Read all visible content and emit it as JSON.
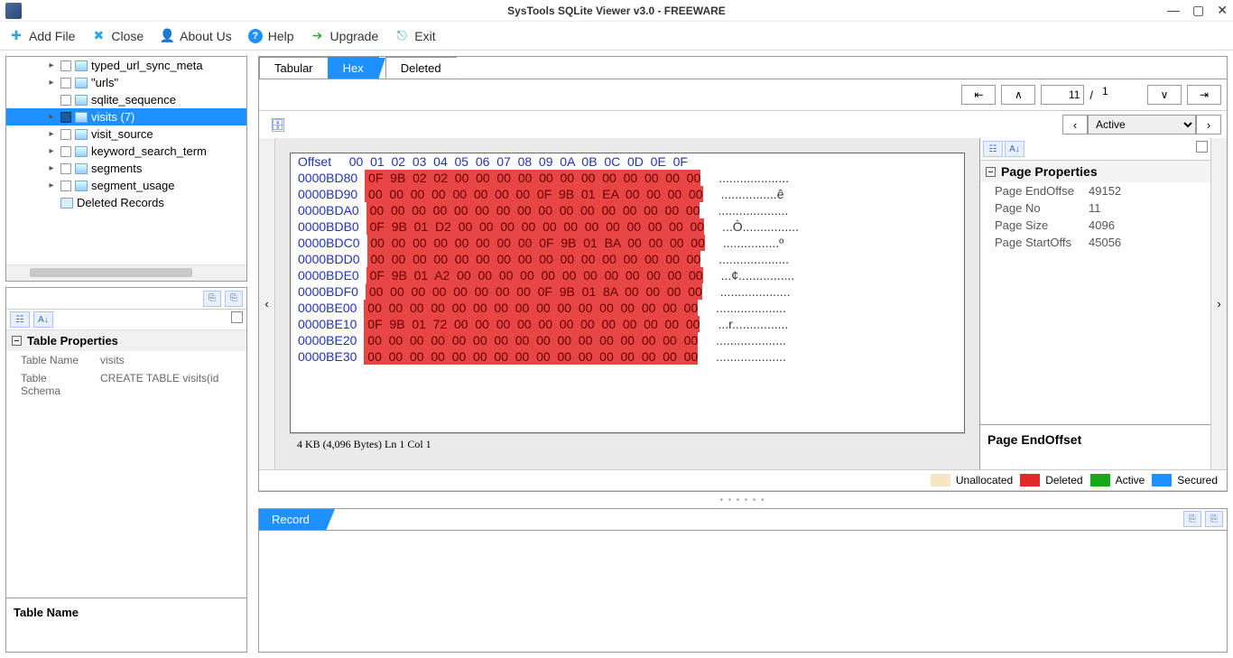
{
  "titlebar": {
    "title": "SysTools SQLite Viewer  v3.0 - FREEWARE"
  },
  "toolbar": {
    "add_file": "Add File",
    "close": "Close",
    "about": "About Us",
    "help": "Help",
    "upgrade": "Upgrade",
    "exit": "Exit"
  },
  "tree": {
    "items": [
      {
        "label": "typed_url_sync_meta",
        "expandable": true
      },
      {
        "label": "\"urls\"",
        "expandable": true
      },
      {
        "label": "sqlite_sequence",
        "expandable": false
      },
      {
        "label": "visits   (7)",
        "expandable": true,
        "selected": true
      },
      {
        "label": "visit_source",
        "expandable": true
      },
      {
        "label": "keyword_search_term",
        "expandable": true
      },
      {
        "label": "segments",
        "expandable": true
      },
      {
        "label": "segment_usage",
        "expandable": true
      },
      {
        "label": "Deleted Records",
        "expandable": false,
        "deleted": true
      }
    ]
  },
  "table_props": {
    "header": "Table Properties",
    "rows": [
      {
        "k": "Table Name",
        "v": "visits"
      },
      {
        "k": "Table Schema",
        "v": "CREATE TABLE visits(id"
      }
    ],
    "desc_title": "Table Name"
  },
  "tabs": {
    "tabular": "Tabular",
    "hex": "Hex",
    "deleted": "Deleted"
  },
  "hex_nav": {
    "page_input": "11",
    "page_total": "1"
  },
  "hex_filter": {
    "selected": "Active"
  },
  "hex": {
    "header_offset": "Offset  ",
    "header_bytes": " 00  01  02  03  04  05  06  07  08  09  0A  0B  0C  0D  0E  0F",
    "rows": [
      {
        "o": "0000BD80",
        "b": " 0F  9B  02  02  00  00  00  00  00  00  00  00  00  00  00  00",
        "a": "...................."
      },
      {
        "o": "0000BD90",
        "b": " 00  00  00  00  00  00  00  00  0F  9B  01  EA  00  00  00  00",
        "a": "................ê"
      },
      {
        "o": "0000BDA0",
        "b": " 00  00  00  00  00  00  00  00  00  00  00  00  00  00  00  00",
        "a": "...................."
      },
      {
        "o": "0000BDB0",
        "b": " 0F  9B  01  D2  00  00  00  00  00  00  00  00  00  00  00  00",
        "a": "...Ò................"
      },
      {
        "o": "0000BDC0",
        "b": " 00  00  00  00  00  00  00  00  0F  9B  01  BA  00  00  00  00",
        "a": "................º"
      },
      {
        "o": "0000BDD0",
        "b": " 00  00  00  00  00  00  00  00  00  00  00  00  00  00  00  00",
        "a": "...................."
      },
      {
        "o": "0000BDE0",
        "b": " 0F  9B  01  A2  00  00  00  00  00  00  00  00  00  00  00  00",
        "a": "...¢................"
      },
      {
        "o": "0000BDF0",
        "b": " 00  00  00  00  00  00  00  00  0F  9B  01  8A  00  00  00  00",
        "a": "...................."
      },
      {
        "o": "0000BE00",
        "b": " 00  00  00  00  00  00  00  00  00  00  00  00  00  00  00  00",
        "a": "...................."
      },
      {
        "o": "0000BE10",
        "b": " 0F  9B  01  72  00  00  00  00  00  00  00  00  00  00  00  00",
        "a": "...r................"
      },
      {
        "o": "0000BE20",
        "b": " 00  00  00  00  00  00  00  00  00  00  00  00  00  00  00  00",
        "a": "...................."
      },
      {
        "o": "0000BE30",
        "b": " 00  00  00  00  00  00  00  00  00  00  00  00  00  00  00  00",
        "a": "...................."
      }
    ],
    "status": "4 KB (4,096 Bytes)   Ln 1    Col 1"
  },
  "page_props": {
    "header": "Page Properties",
    "rows": [
      {
        "k": "Page EndOffse",
        "v": "49152"
      },
      {
        "k": "Page No",
        "v": "11"
      },
      {
        "k": "Page Size",
        "v": "4096"
      },
      {
        "k": "Page StartOffs",
        "v": "45056"
      }
    ],
    "desc_title": "Page EndOffset"
  },
  "legend": {
    "items": [
      {
        "label": "Unallocated",
        "color": "#f7e6c2"
      },
      {
        "label": "Deleted",
        "color": "#e22828"
      },
      {
        "label": "Active",
        "color": "#16a816"
      },
      {
        "label": "Secured",
        "color": "#1e90ff"
      }
    ]
  },
  "record": {
    "tab": "Record"
  }
}
